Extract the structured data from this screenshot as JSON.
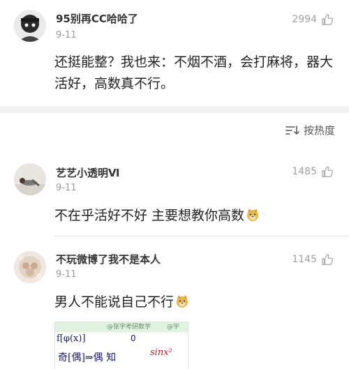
{
  "comments": [
    {
      "username": "95别再CC哈哈了",
      "date": "9-11",
      "likes": "2994",
      "text": "还挺能整？我也来：不烟不酒，会打麻将，器大活好，高数真不行。"
    },
    {
      "username": "艺艺小透明Ⅵ",
      "date": "9-11",
      "likes": "1485",
      "text": "不在乎活好不好 主要想教你高数"
    },
    {
      "username": "不玩微博了我不是本人",
      "date": "9-11",
      "likes": "1145",
      "text": "男人不能说自己不行"
    }
  ],
  "sort": {
    "label": "按热度",
    "icon": "sort-icon"
  },
  "image": {
    "watermark_1": "@张宇考研数学",
    "watermark_2": "@宇",
    "line1": "f[φ(x)]",
    "mark": "0",
    "line2": "奇[偶]⇒偶 知",
    "sup": "sinx²"
  },
  "colors": {
    "divider": "#f2f2f2",
    "meta": "#9a9a9a",
    "text": "#222222"
  }
}
